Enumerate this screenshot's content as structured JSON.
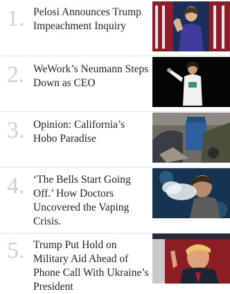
{
  "trending": {
    "items": [
      {
        "rank": "1.",
        "headline": "Pelosi Announces Trump Impeachment Inquiry",
        "thumb_alt": "Nancy Pelosi at podium with American flags"
      },
      {
        "rank": "2.",
        "headline": "WeWork’s Neumann Steps Down as CEO",
        "thumb_alt": "Adam Neumann on stage"
      },
      {
        "rank": "3.",
        "headline": "Opinion: California’s Hobo Paradise",
        "thumb_alt": "Homeless encampment with tents and trash bins"
      },
      {
        "rank": "4.",
        "headline": "‘The Bells Start Going Off.’ How Doctors Uncovered the Vaping Crisis.",
        "thumb_alt": "Man exhaling vape cloud"
      },
      {
        "rank": "5.",
        "headline": "Trump Put Hold on Military Aid Ahead of Phone Call With Ukraine’s President",
        "thumb_alt": "Donald Trump pointing"
      }
    ]
  }
}
